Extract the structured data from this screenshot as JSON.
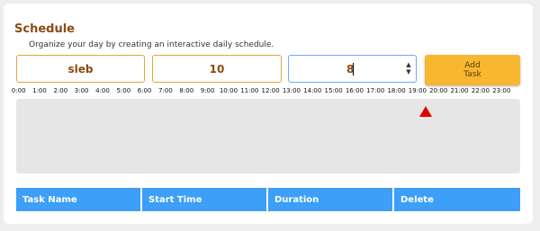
{
  "app": {
    "title": "Schedule",
    "subtitle": "Organize your day by creating an interactive daily schedule."
  },
  "form": {
    "task_name": "sleb",
    "start_time": "10",
    "duration": "8",
    "add_label": "Add\nTask"
  },
  "timeline": {
    "hours": [
      "0:00",
      "1:00",
      "2:00",
      "3:00",
      "4:00",
      "5:00",
      "6:00",
      "7:00",
      "8:00",
      "9:00",
      "10:00",
      "11:00",
      "12:00",
      "13:00",
      "14:00",
      "15:00",
      "16:00",
      "17:00",
      "18:00",
      "19:00",
      "20:00",
      "21:00",
      "22:00",
      "23:00"
    ]
  },
  "table": {
    "headers": [
      "Task Name",
      "Start Time",
      "Duration",
      "Delete"
    ]
  },
  "colors": {
    "accent": "#f7b731",
    "header_blue": "#3d9ff7",
    "marker_red": "#e00000",
    "title_brown": "#8b4a12"
  }
}
